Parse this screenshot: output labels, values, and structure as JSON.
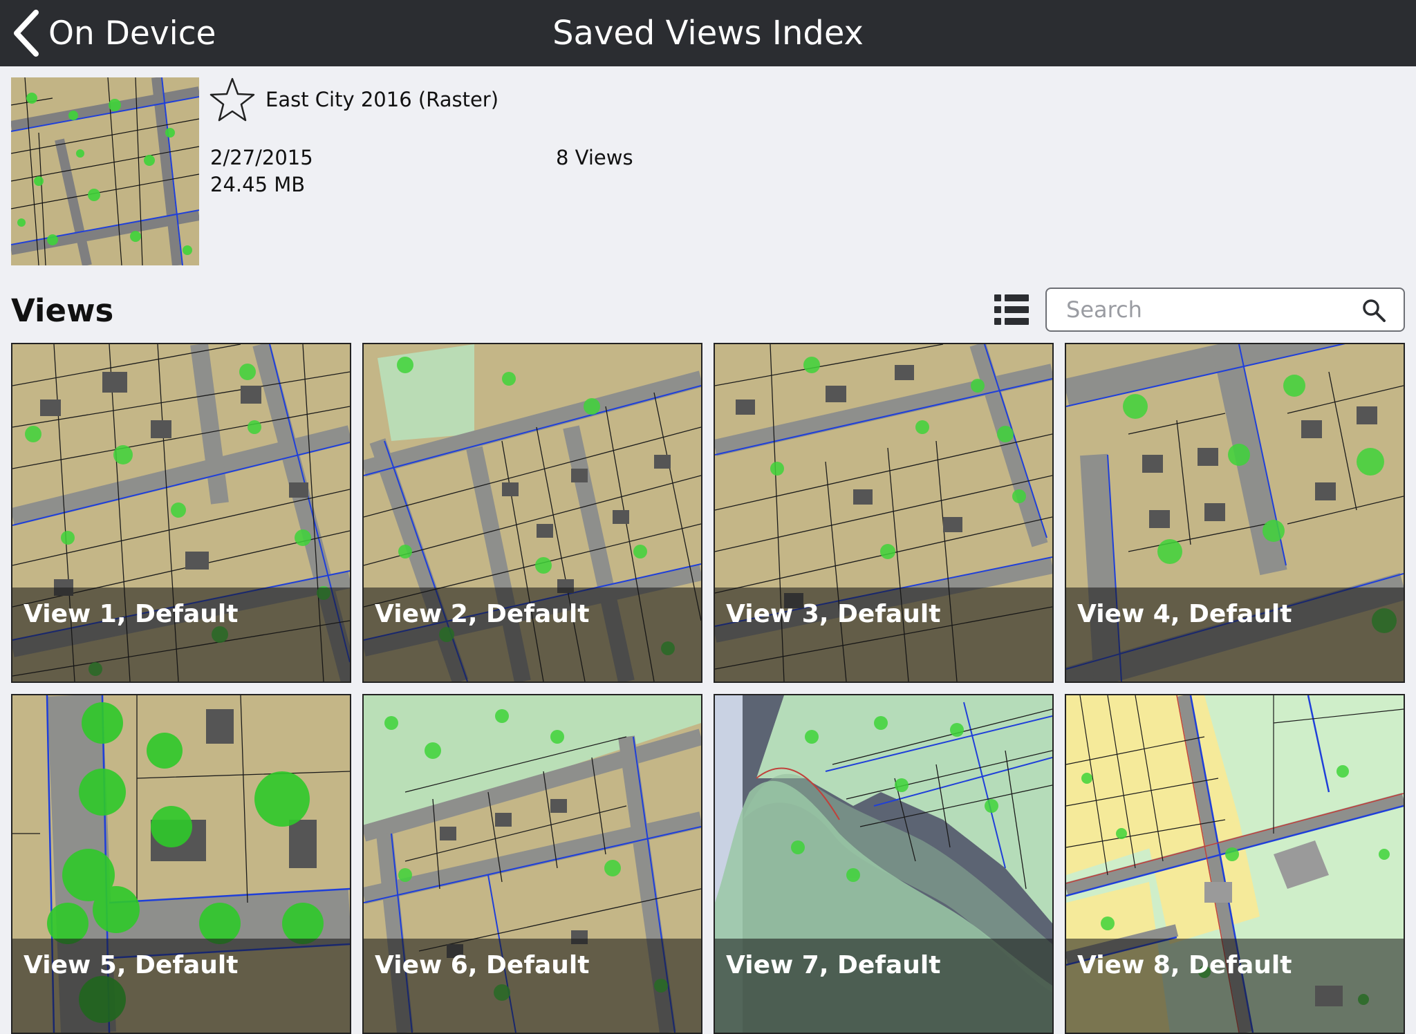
{
  "header": {
    "back_label": "On Device",
    "title": "Saved Views Index"
  },
  "layer": {
    "name": "East City 2016 (Raster)",
    "date": "2/27/2015",
    "size": "24.45 MB",
    "view_count": "8 Views",
    "favorite": false
  },
  "views_section": {
    "heading": "Views",
    "search_placeholder": "Search"
  },
  "views": [
    {
      "label": "View 1, Default"
    },
    {
      "label": "View 2, Default"
    },
    {
      "label": "View 3, Default"
    },
    {
      "label": "View 4, Default"
    },
    {
      "label": "View 5, Default"
    },
    {
      "label": "View 6, Default"
    },
    {
      "label": "View 7, Default"
    },
    {
      "label": "View 8, Default"
    }
  ],
  "colors": {
    "header_bg": "#2b2d31",
    "page_bg": "#eff0f4",
    "parcel_fill": "#c4b687",
    "tree_green": "#3fd43a",
    "road_gray": "#8e8f8c",
    "parcel_line": "#1a1a1a",
    "street_line": "#1f3fd9"
  }
}
